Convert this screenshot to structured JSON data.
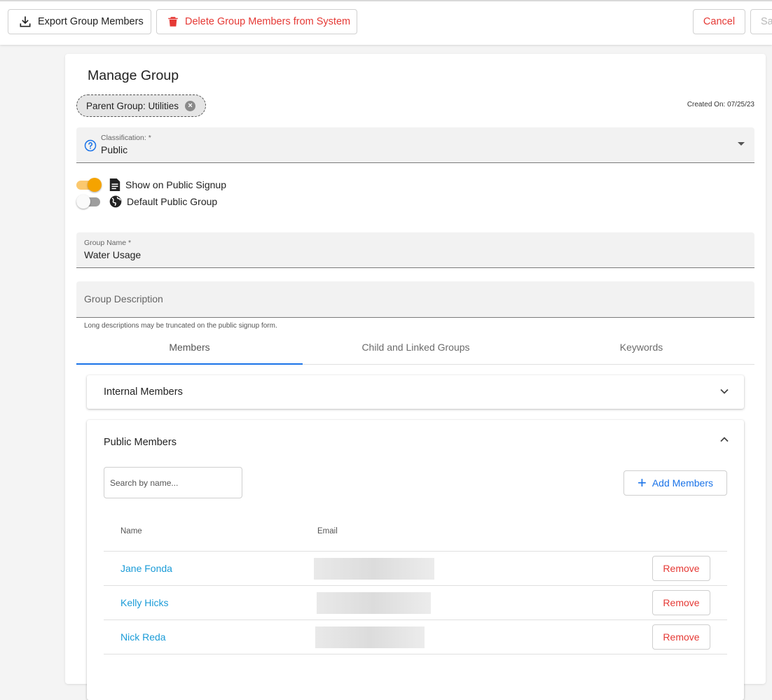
{
  "toolbar": {
    "export_label": "Export Group Members",
    "delete_label": "Delete Group Members from System",
    "cancel_label": "Cancel",
    "save_label": "Sa"
  },
  "page": {
    "title": "Manage Group",
    "parent_chip": "Parent Group: Utilities",
    "created_on": "Created On: 07/25/23"
  },
  "classification": {
    "label": "Classification: *",
    "value": "Public"
  },
  "toggles": [
    {
      "label": "Show on Public Signup",
      "on": true,
      "icon": "document-icon"
    },
    {
      "label": "Default Public Group",
      "on": false,
      "icon": "globe-icon"
    }
  ],
  "group_name": {
    "label": "Group Name *",
    "value": "Water Usage"
  },
  "group_description": {
    "placeholder": "Group Description",
    "hint": "Long descriptions may be truncated on the public signup form."
  },
  "tabs": [
    {
      "label": "Members",
      "active": true
    },
    {
      "label": "Child and Linked Groups",
      "active": false
    },
    {
      "label": "Keywords",
      "active": false
    }
  ],
  "internal_members": {
    "title": "Internal Members"
  },
  "public_members": {
    "title": "Public Members",
    "search_placeholder": "Search by name...",
    "add_label": "Add Members",
    "columns": {
      "name": "Name",
      "email": "Email"
    },
    "rows": [
      {
        "name": "Jane Fonda",
        "action": "Remove"
      },
      {
        "name": "Kelly Hicks",
        "action": "Remove"
      },
      {
        "name": "Nick Reda",
        "action": "Remove"
      }
    ]
  },
  "colors": {
    "accent": "#1a73e8",
    "danger": "#e53935",
    "toggle_on": "#f5a300",
    "link": "#1a9bd7"
  }
}
